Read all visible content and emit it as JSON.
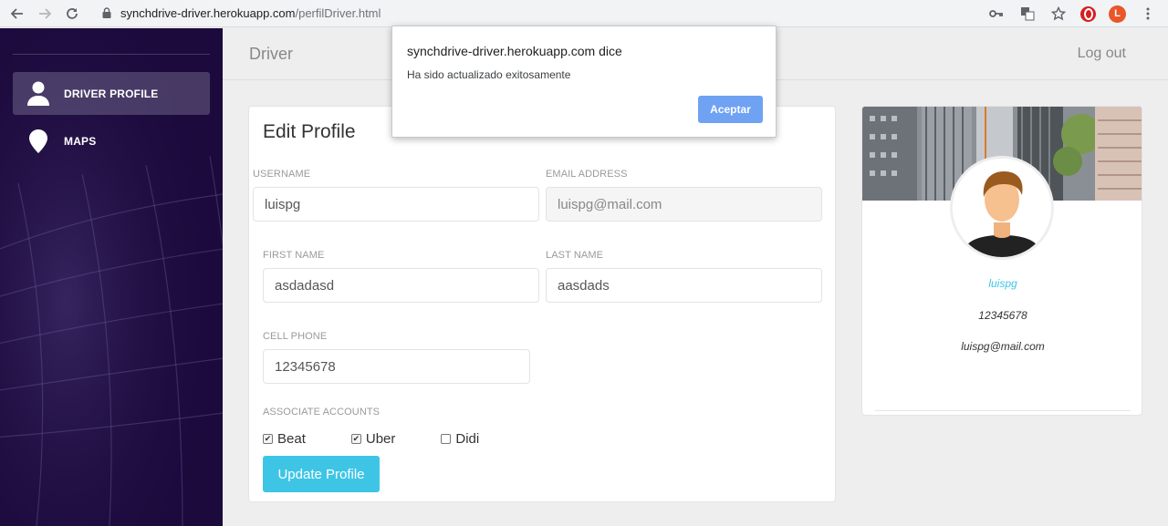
{
  "browser": {
    "url_host": "synchdrive-driver.herokuapp.com",
    "url_path": "/perfilDriver.html",
    "profile_initial": "L"
  },
  "sidebar": {
    "items": [
      {
        "label": "DRIVER PROFILE",
        "icon": "user-icon",
        "active": true
      },
      {
        "label": "MAPS",
        "icon": "map-pin-icon",
        "active": false
      }
    ]
  },
  "topnav": {
    "brand": "Driver",
    "logout": "Log out"
  },
  "edit_profile": {
    "title": "Edit Profile",
    "username_label": "USERNAME",
    "username_value": "luispg",
    "email_label": "EMAIL ADDRESS",
    "email_value": "luispg@mail.com",
    "first_name_label": "FIRST NAME",
    "first_name_value": "asdadasd",
    "last_name_label": "LAST NAME",
    "last_name_value": "aasdads",
    "cell_phone_label": "CELL PHONE",
    "cell_phone_value": "12345678",
    "accounts_label": "ASSOCIATE ACCOUNTS",
    "accounts": [
      {
        "label": "Beat",
        "checked": true
      },
      {
        "label": "Uber",
        "checked": true
      },
      {
        "label": "Didi",
        "checked": false
      }
    ],
    "update_label": "Update Profile"
  },
  "profile_card": {
    "username": "luispg",
    "phone": "12345678",
    "email": "luispg@mail.com"
  },
  "dialog": {
    "title": "synchdrive-driver.herokuapp.com dice",
    "message": "Ha sido actualizado exitosamente",
    "button": "Aceptar"
  },
  "colors": {
    "sidebar_bg": "#1c0a3d",
    "accent": "#3ec5e6",
    "dialog_button": "#6fa2f3"
  }
}
